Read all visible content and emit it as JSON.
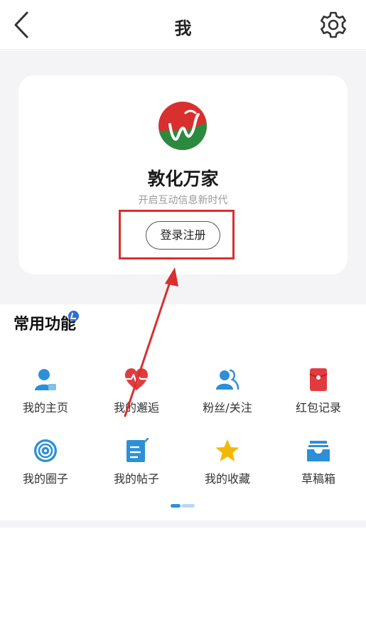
{
  "header": {
    "title": "我",
    "back_icon": "chevron-left-icon",
    "settings_icon": "gear-icon"
  },
  "profile": {
    "app_name": "敦化万家",
    "slogan": "开启互动信息新时代",
    "login_label": "登录注册",
    "logo_colors": {
      "red": "#d8302e",
      "green": "#2a8a3e"
    }
  },
  "functions": {
    "title": "常用功能",
    "items": [
      {
        "label": "我的主页",
        "icon": "user-home-icon"
      },
      {
        "label": "我的邂逅",
        "icon": "heartbeat-icon"
      },
      {
        "label": "粉丝/关注",
        "icon": "followers-icon"
      },
      {
        "label": "红包记录",
        "icon": "red-envelope-icon"
      },
      {
        "label": "我的圈子",
        "icon": "circle-icon"
      },
      {
        "label": "我的帖子",
        "icon": "post-edit-icon"
      },
      {
        "label": "我的收藏",
        "icon": "star-icon"
      },
      {
        "label": "草稿箱",
        "icon": "drafts-inbox-icon"
      }
    ]
  },
  "colors": {
    "accent_blue": "#2c8fd8",
    "annotation_red": "#d8302e",
    "star_yellow": "#f5b800"
  }
}
